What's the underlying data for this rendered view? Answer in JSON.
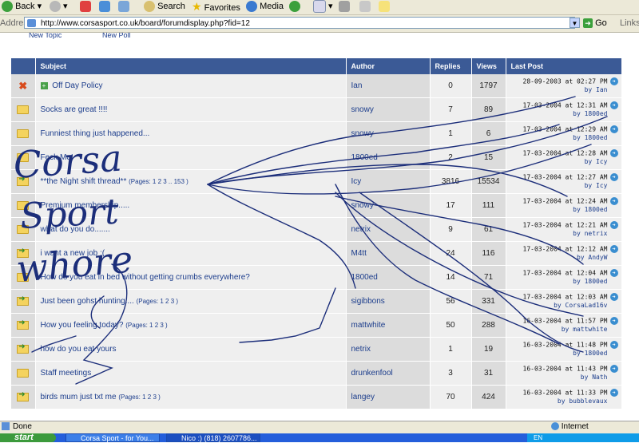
{
  "toolbar": {
    "back_label": "Back",
    "search_label": "Search",
    "favorites_label": "Favorites",
    "media_label": "Media"
  },
  "address": {
    "label": "Address",
    "url": "http://www.corsasport.co.uk/board/forumdisplay.php?fid=12",
    "go_label": "Go",
    "links_label": "Links"
  },
  "forum": {
    "new_topic_label": "New Topic",
    "new_poll_label": "New Poll",
    "headers": {
      "subject": "Subject",
      "author": "Author",
      "replies": "Replies",
      "views": "Views",
      "last_post": "Last Post"
    },
    "threads": [
      {
        "icon": "closed-folder-icon",
        "sticky": true,
        "subject": "Off Day Policy",
        "pages": "",
        "author": "Ian",
        "replies": "0",
        "views": "1797",
        "last_date": "28-09-2003 at 02:27 PM",
        "last_by": "by Ian"
      },
      {
        "icon": "folder-icon",
        "sticky": false,
        "subject": "Socks are great !!!!",
        "pages": "",
        "author": "snowy",
        "replies": "7",
        "views": "89",
        "last_date": "17-03-2004 at 12:31 AM",
        "last_by": "by 1800ed"
      },
      {
        "icon": "folder-icon",
        "sticky": false,
        "subject": "Funniest thing just happened...",
        "pages": "",
        "author": "snowy",
        "replies": "1",
        "views": "6",
        "last_date": "17-03-2004 at 12:29 AM",
        "last_by": "by 1800ed"
      },
      {
        "icon": "folder-icon",
        "sticky": false,
        "subject": "Feck Me!",
        "pages": "",
        "author": "1800ed",
        "replies": "2",
        "views": "15",
        "last_date": "17-03-2004 at 12:28 AM",
        "last_by": "by Icy"
      },
      {
        "icon": "hot-folder-icon",
        "sticky": false,
        "subject": "**the Night shift thread**",
        "pages": "(Pages: 1 2 3 .. 153 )",
        "author": "Icy",
        "replies": "3816",
        "views": "15534",
        "last_date": "17-03-2004 at 12:27 AM",
        "last_by": "by Icy"
      },
      {
        "icon": "folder-icon",
        "sticky": false,
        "subject": "Premium membership.....",
        "pages": "",
        "author": "snowy",
        "replies": "17",
        "views": "111",
        "last_date": "17-03-2004 at 12:24 AM",
        "last_by": "by 1800ed"
      },
      {
        "icon": "folder-icon",
        "sticky": false,
        "subject": "what do you do.......",
        "pages": "",
        "author": "netrix",
        "replies": "9",
        "views": "61",
        "last_date": "17-03-2004 at 12:21 AM",
        "last_by": "by netrix"
      },
      {
        "icon": "new-folder-icon",
        "sticky": false,
        "subject": "i want a new job :(",
        "pages": "",
        "author": "M4tt",
        "replies": "24",
        "views": "116",
        "last_date": "17-03-2004 at 12:12 AM",
        "last_by": "by AndyW"
      },
      {
        "icon": "folder-icon",
        "sticky": false,
        "subject": "How do you eat in bed without getting crumbs everywhere?",
        "pages": "",
        "author": "1800ed",
        "replies": "14",
        "views": "71",
        "last_date": "17-03-2004 at 12:04 AM",
        "last_by": "by 1800ed"
      },
      {
        "icon": "new-folder-icon",
        "sticky": false,
        "subject": "Just been gohst hunting....",
        "pages": "(Pages: 1 2 3 )",
        "author": "sigibbons",
        "replies": "56",
        "views": "331",
        "last_date": "17-03-2004 at 12:03 AM",
        "last_by": "by CorsaLad16v"
      },
      {
        "icon": "new-folder-icon",
        "sticky": false,
        "subject": "How you feeling today?",
        "pages": "(Pages: 1 2 3 )",
        "author": "mattwhite",
        "replies": "50",
        "views": "288",
        "last_date": "16-03-2004 at 11:57 PM",
        "last_by": "by mattwhite"
      },
      {
        "icon": "new-folder-icon",
        "sticky": false,
        "subject": "how do you eat yours",
        "pages": "",
        "author": "netrix",
        "replies": "1",
        "views": "19",
        "last_date": "16-03-2004 at 11:48 PM",
        "last_by": "by 1800ed"
      },
      {
        "icon": "folder-icon",
        "sticky": false,
        "subject": "Staff meetings",
        "pages": "",
        "author": "drunkenfool",
        "replies": "3",
        "views": "31",
        "last_date": "16-03-2004 at 11:43 PM",
        "last_by": "by Nath"
      },
      {
        "icon": "new-folder-icon",
        "sticky": false,
        "subject": "birds mum just txt me",
        "pages": "(Pages: 1 2 3 )",
        "author": "langey",
        "replies": "70",
        "views": "424",
        "last_date": "16-03-2004 at 11:33 PM",
        "last_by": "by bubblevaux"
      }
    ]
  },
  "scribble_text": [
    "Corsa",
    "Sport",
    "whore"
  ],
  "status": {
    "left": "Done",
    "zone": "Internet"
  },
  "taskbar": {
    "start_label": "start",
    "tasks": [
      "Corsa Sport - for You...",
      "Nico :) (818) 2607786..."
    ],
    "tray_text": "EN"
  },
  "colors": {
    "header_bg": "#3b5a96",
    "link": "#1c3d8c",
    "row_light": "#efefef",
    "row_dark": "#dcdcdc"
  }
}
